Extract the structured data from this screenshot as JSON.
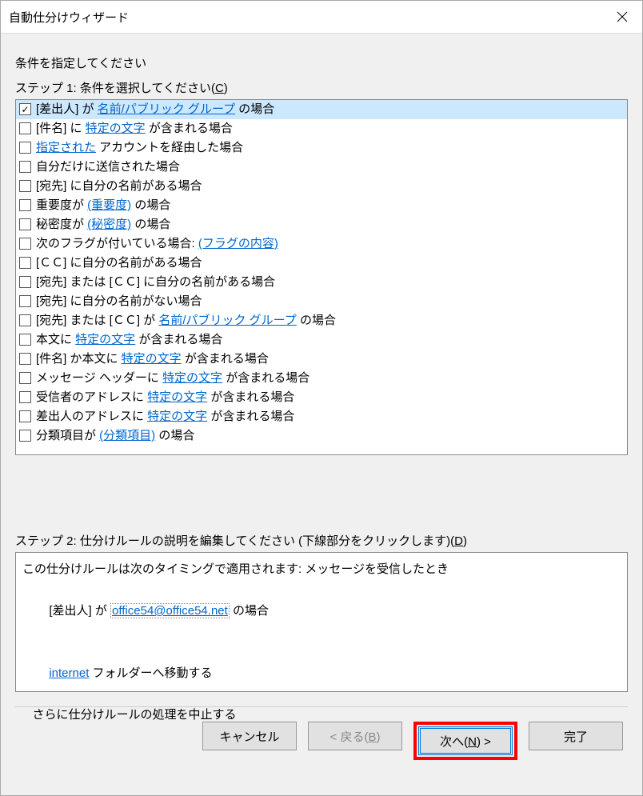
{
  "window": {
    "title": "自動仕分けウィザード"
  },
  "heading": "条件を指定してください",
  "step1": {
    "label_pre": "ステップ 1: 条件を選択してください(",
    "label_acc": "C",
    "label_post": ")"
  },
  "conditions": [
    {
      "checked": true,
      "selected": true,
      "parts": [
        "[差出人] が ",
        {
          "link": "名前/パブリック グループ"
        },
        " の場合"
      ]
    },
    {
      "checked": false,
      "selected": false,
      "parts": [
        "[件名] に ",
        {
          "link": "特定の文字"
        },
        " が含まれる場合"
      ]
    },
    {
      "checked": false,
      "selected": false,
      "parts": [
        {
          "link": "指定された"
        },
        " アカウントを経由した場合"
      ]
    },
    {
      "checked": false,
      "selected": false,
      "parts": [
        "自分だけに送信された場合"
      ]
    },
    {
      "checked": false,
      "selected": false,
      "parts": [
        "[宛先] に自分の名前がある場合"
      ]
    },
    {
      "checked": false,
      "selected": false,
      "parts": [
        "重要度が ",
        {
          "link": "(重要度)"
        },
        " の場合"
      ]
    },
    {
      "checked": false,
      "selected": false,
      "parts": [
        "秘密度が ",
        {
          "link": "(秘密度)"
        },
        " の場合"
      ]
    },
    {
      "checked": false,
      "selected": false,
      "parts": [
        "次のフラグが付いている場合: ",
        {
          "link": "(フラグの内容)"
        }
      ]
    },
    {
      "checked": false,
      "selected": false,
      "parts": [
        "[ＣＣ] に自分の名前がある場合"
      ]
    },
    {
      "checked": false,
      "selected": false,
      "parts": [
        "[宛先] または [ＣＣ] に自分の名前がある場合"
      ]
    },
    {
      "checked": false,
      "selected": false,
      "parts": [
        "[宛先] に自分の名前がない場合"
      ]
    },
    {
      "checked": false,
      "selected": false,
      "parts": [
        "[宛先] または [ＣＣ] が ",
        {
          "link": "名前/パブリック グループ"
        },
        " の場合"
      ]
    },
    {
      "checked": false,
      "selected": false,
      "parts": [
        "本文に ",
        {
          "link": "特定の文字"
        },
        " が含まれる場合"
      ]
    },
    {
      "checked": false,
      "selected": false,
      "parts": [
        "[件名] か本文に ",
        {
          "link": "特定の文字"
        },
        " が含まれる場合"
      ]
    },
    {
      "checked": false,
      "selected": false,
      "parts": [
        "メッセージ ヘッダーに ",
        {
          "link": "特定の文字"
        },
        " が含まれる場合"
      ]
    },
    {
      "checked": false,
      "selected": false,
      "parts": [
        "受信者のアドレスに ",
        {
          "link": "特定の文字"
        },
        " が含まれる場合"
      ]
    },
    {
      "checked": false,
      "selected": false,
      "parts": [
        "差出人のアドレスに ",
        {
          "link": "特定の文字"
        },
        " が含まれる場合"
      ]
    },
    {
      "checked": false,
      "selected": false,
      "parts": [
        "分類項目が ",
        {
          "link": "(分類項目)"
        },
        " の場合"
      ]
    }
  ],
  "step2": {
    "label_pre": "ステップ 2: 仕分けルールの説明を編集してください (下線部分をクリックします)(",
    "label_acc": "D",
    "label_post": ")"
  },
  "description": {
    "line1": "この仕分けルールは次のタイミングで適用されます: メッセージを受信したとき",
    "line2_pre": "[差出人] が ",
    "line2_link": "office54@office54.net",
    "line2_post": " の場合",
    "line3_link": "internet",
    "line3_post": " フォルダーへ移動する",
    "line4": "   さらに仕分けルールの処理を中止する"
  },
  "buttons": {
    "cancel": "キャンセル",
    "back_pre": "< 戻る(",
    "back_acc": "B",
    "back_post": ")",
    "next_pre": "次へ(",
    "next_acc": "N",
    "next_post": ") >",
    "finish": "完了"
  }
}
